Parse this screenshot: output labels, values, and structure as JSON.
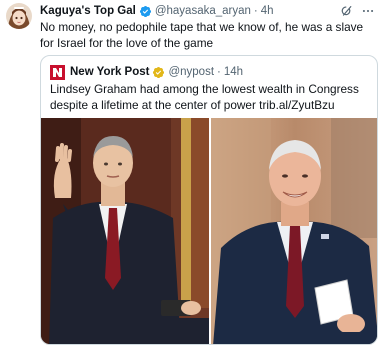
{
  "tweet": {
    "author": {
      "display_name": "Kaguya's Top Gal",
      "handle": "@hayasaka_aryan",
      "separator": "·",
      "time": "4h",
      "verified": true
    },
    "text": "No money, no pedophile tape that we know of, he was a slave for Israel for the love of the game",
    "quoted": {
      "author": {
        "display_name": "New York Post",
        "handle": "@nypost",
        "separator": "·",
        "time": "14h",
        "verified": true
      },
      "text": "Lindsey Graham had among the lowest wealth in Congress despite a lifetime at the center of power trib.al/ZyutBzu",
      "media": [
        {
          "description_icon": "photo-icon"
        },
        {
          "description_icon": "photo-icon"
        }
      ]
    }
  },
  "colors": {
    "verified": "#1d9bf0",
    "quote_verified_gold": "#e2b719",
    "nyp_red": "#c8102e",
    "muted": "#536471",
    "border": "#cfd9de"
  },
  "icons": {
    "grok": "grok-icon",
    "more": "more-icon"
  }
}
